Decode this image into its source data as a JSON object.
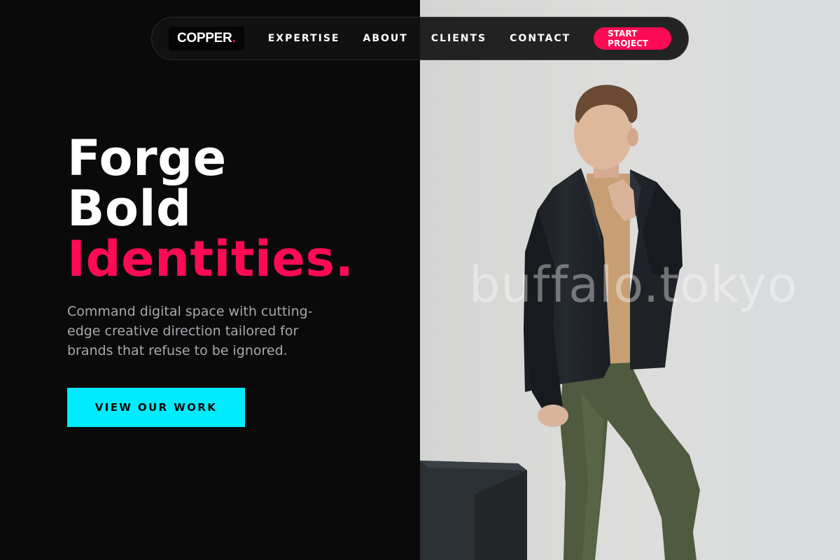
{
  "nav": {
    "logo_text": "COPPER",
    "logo_dot": ".",
    "links": [
      "EXPERTISE",
      "ABOUT",
      "CLIENTS",
      "CONTACT"
    ],
    "cta_label": "START PROJECT"
  },
  "hero": {
    "title_line1": "Forge",
    "title_line2": "Bold",
    "title_line3": "Identities.",
    "description": "Command digital space with cutting-edge creative direction tailored for brands that refuse to be ignored.",
    "button_label": "VIEW OUR WORK"
  },
  "photo": {
    "watermark": "buffalo.tokyo"
  },
  "colors": {
    "background": "#0a0a0b",
    "accent_pink": "#ff0a54",
    "accent_cyan": "#00ecfd",
    "text_muted": "#a9a9ae"
  }
}
